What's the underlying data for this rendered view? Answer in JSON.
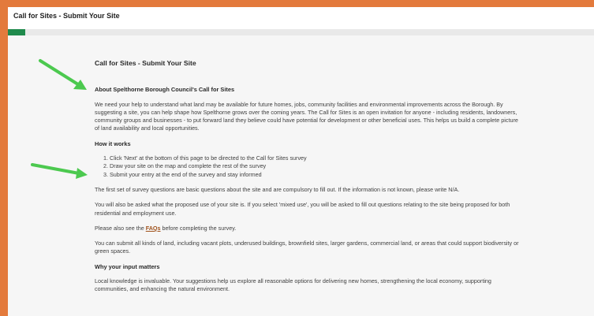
{
  "window": {
    "title": "Call for Sites - Submit Your Site"
  },
  "progress": {
    "fraction": 0.03,
    "color": "#1f8a4c"
  },
  "page": {
    "heading": "Call for Sites - Submit Your Site",
    "about_heading": "About Spelthorne Borough Council's Call for Sites",
    "intro": "We need your help to understand what land may be available for future homes, jobs, community facilities and environmental improvements across the Borough. By suggesting a site, you can help shape how Spelthorne grows over the coming years. The Call for Sites is an open invitation for anyone - including residents, landowners, community groups and businesses - to put forward land they believe could have potential for development or other beneficial uses. This helps us build a complete picture of land availability and local opportunities.",
    "how_heading": "How it works",
    "steps": [
      "Click 'Next' at the bottom of this page to be directed to the Call for Sites survey",
      "Draw your site on the map and complete the rest of the survey",
      "Submit your entry at the end of the survey and stay informed"
    ],
    "para_basic": "The first set of survey questions are basic questions about the site and are compulsory to fill out. If the information is not known, please write N/A.",
    "para_mixed": "You will also be asked what the proposed use of your site is. If you select 'mixed use', you will be asked to fill out questions relating to the site being proposed for both residential and employment use.",
    "faq_before": "Please also see the ",
    "faq_link": "FAQs",
    "faq_after": " before completing the survey.",
    "para_land": "You can submit all kinds of land, including vacant plots, underused buildings, brownfield sites, larger gardens, commercial land, or areas that could support biodiversity or green spaces.",
    "why_heading": "Why your input matters",
    "para_local": "Local knowledge is invaluable. Your suggestions help us explore all reasonable options for delivering new homes, strengthening the local economy, supporting communities, and enhancing the natural environment."
  },
  "annotations": {
    "arrow_color": "#4cc94f"
  }
}
